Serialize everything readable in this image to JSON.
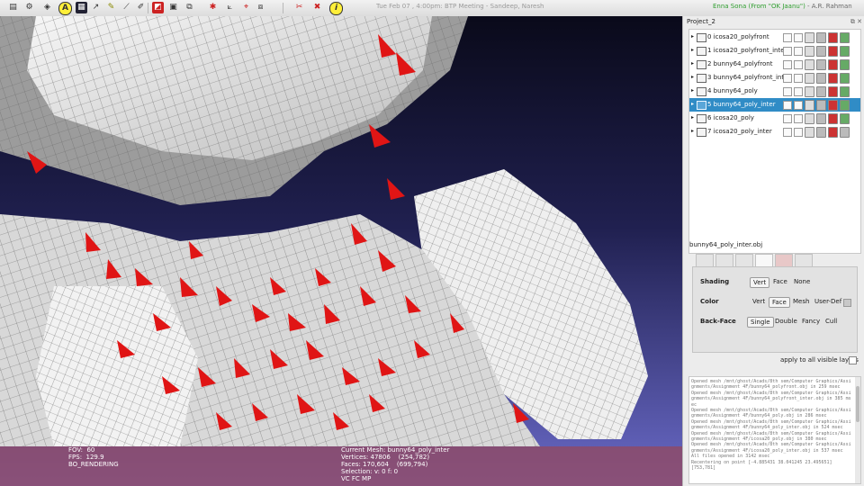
{
  "toolbar": {
    "icons": [
      "file-icon",
      "gear-icon",
      "mesh-icon",
      "annotation-icon",
      "snapshot-icon",
      "axis-icon",
      "paint-icon",
      "brush-icon",
      "edit-icon",
      "select-icon",
      "cube-icon",
      "layers-icon",
      "star-icon",
      "measure-icon",
      "tag-icon",
      "align-icon",
      "transfer-icon",
      "info-icon"
    ],
    "clock": "Tue Feb 07 , 4:00pm: BTP Meeting - Sandeep, Naresh",
    "now_playing_title": "Enna Sona (From \"OK Jaanu\")",
    "now_playing_artist": " - A.R. Rahman"
  },
  "viewport": {
    "hud_left": [
      "FOV:  60",
      "FPS:  129.9",
      "BO_RENDERING"
    ],
    "hud_center": [
      "Current Mesh: bunny64_poly_inter",
      "Vertices: 47806    (254,782)",
      "Faces: 170,604    (699,794)",
      "Selection: v: 0 f: 0",
      "VC FC MP"
    ]
  },
  "panel": {
    "project_title": "Project_2",
    "layers": [
      {
        "label": "0  icosa20_polyfront",
        "selected": false
      },
      {
        "label": "1  icosa20_polyfront_inter",
        "selected": false
      },
      {
        "label": "2  bunny64_polyfront",
        "selected": false
      },
      {
        "label": "3  bunny64_polyfront_inter",
        "selected": false
      },
      {
        "label": "4  bunny64_poly",
        "selected": false
      },
      {
        "label": "5  bunny64_poly_inter",
        "selected": true
      },
      {
        "label": "6  icosa20_poly",
        "selected": false
      },
      {
        "label": "7  icosa20_poly_inter",
        "selected": false
      }
    ],
    "mesh_name": "bunny64_poly_inter.obj",
    "shading": {
      "label": "Shading",
      "options": [
        "Vert",
        "Face",
        "None"
      ],
      "selected": "Vert"
    },
    "color": {
      "label": "Color",
      "options": [
        "Vert",
        "Face",
        "Mesh",
        "User-Def"
      ],
      "selected": "Face"
    },
    "backface": {
      "label": "Back-Face",
      "options": [
        "Single",
        "Double",
        "Fancy",
        "Cull"
      ],
      "selected": "Single"
    },
    "apply_label": "apply to all visible layers",
    "log": "Opened mesh /mnt/ghost/Acads/8th sem/Computer Graphics/Assignments/Assignment 4F/bunny64_polyfront.obj in 259 msec\nOpened mesh /mnt/ghost/Acads/8th sem/Computer Graphics/Assignments/Assignment 4F/bunny64_polyfront_inter.obj in 385 msec\nOpened mesh /mnt/ghost/Acads/8th sem/Computer Graphics/Assignments/Assignment 4F/bunny64_poly.obj in 286 msec\nOpened mesh /mnt/ghost/Acads/8th sem/Computer Graphics/Assignments/Assignment 4F/bunny64_poly_inter.obj in 524 msec\nOpened mesh /mnt/ghost/Acads/8th sem/Computer Graphics/Assignments/Assignment 4F/icosa20_poly.obj in 380 msec\nOpened mesh /mnt/ghost/Acads/8th sem/Computer Graphics/Assignments/Assignment 4F/icosa20_poly_inter.obj in 537 msec\nAll files opened in 3142 msec\nRecentering on point [-4.885431 38.041245 23.495651]\n[753,781]"
  },
  "colors": {
    "selected_row": "#308cc6",
    "face_red": "#e01515",
    "now_playing": "#2e9e2e"
  }
}
